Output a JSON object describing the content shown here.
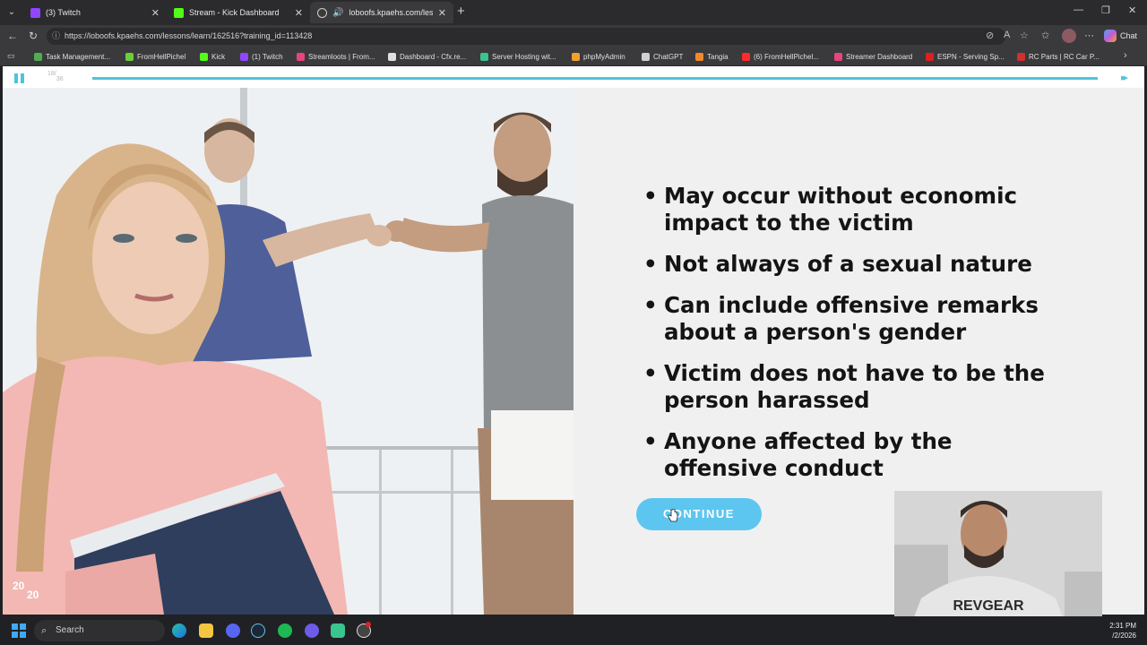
{
  "browser": {
    "tabs": [
      {
        "label": "(3) Twitch",
        "color": "#9146ff"
      },
      {
        "label": "Stream - Kick Dashboard",
        "color": "#53fc18"
      },
      {
        "label": "loboofs.kpaehs.com/lessons/l",
        "color": "#cfcfcf"
      }
    ],
    "address": "https://loboofs.kpaehs.com/lessons/learn/162516?training_id=113428",
    "chat_label": "Chat",
    "bookmarks": [
      {
        "label": "Task Management...",
        "color": "#4caf50"
      },
      {
        "label": "FromHellPichel",
        "color": "#6ccf3a"
      },
      {
        "label": "Kick",
        "color": "#53fc18"
      },
      {
        "label": "(1) Twitch",
        "color": "#9146ff"
      },
      {
        "label": "Streamloots | From...",
        "color": "#e8457a"
      },
      {
        "label": "Dashboard - Cfx.re...",
        "color": "#e0e0e0"
      },
      {
        "label": "Server Hosting wit...",
        "color": "#3ac48e"
      },
      {
        "label": "phpMyAdmin",
        "color": "#f0a030"
      },
      {
        "label": "ChatGPT",
        "color": "#d0d0d0"
      },
      {
        "label": "Tangia",
        "color": "#f08a2a"
      },
      {
        "label": "(6) FromHellPichel...",
        "color": "#ff2b2b"
      },
      {
        "label": "Streamer Dashboard",
        "color": "#e8457a"
      },
      {
        "label": "ESPN - Serving Sp...",
        "color": "#e02020"
      },
      {
        "label": "RC Parts | RC Car P...",
        "color": "#d03030"
      }
    ]
  },
  "lesson": {
    "slide_current": "18",
    "slide_total": "36",
    "progress": 1.0,
    "bullets": [
      "May occur without economic impact to the victim",
      "Not always of a sexual nature",
      "Can include offensive remarks about a person's gender",
      "Victim does not have to be the person harassed",
      "Anyone affected by the offensive conduct"
    ],
    "continue_label": "CONTINUE",
    "logo_top": "20",
    "logo_bottom": "20",
    "accent": "#4dc4da",
    "button_color": "#5cc6f0"
  },
  "webcam": {
    "shirt_text": "REVGEAR"
  },
  "taskbar": {
    "search_label": "Search",
    "time": "2:31 PM",
    "date": "/2/2026"
  }
}
